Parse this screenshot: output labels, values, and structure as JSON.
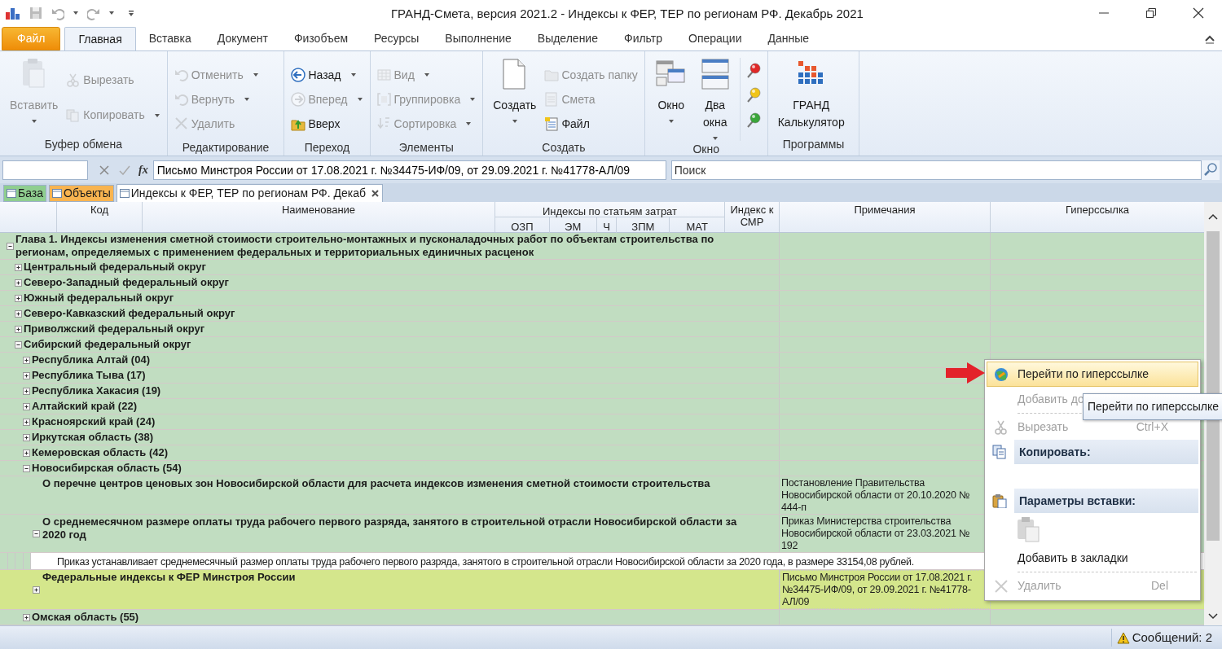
{
  "window": {
    "title": "ГРАНД-Смета, версия 2021.2 - Индексы к ФЕР, ТЕР по регионам РФ. Декабрь 2021"
  },
  "ribbon_tabs": [
    {
      "label": "Файл",
      "kind": "file",
      "selected": false
    },
    {
      "label": "Главная",
      "kind": "tab",
      "selected": true
    },
    {
      "label": "Вставка",
      "kind": "tab",
      "selected": false
    },
    {
      "label": "Документ",
      "kind": "tab",
      "selected": false
    },
    {
      "label": "Физобъем",
      "kind": "tab",
      "selected": false
    },
    {
      "label": "Ресурсы",
      "kind": "tab",
      "selected": false
    },
    {
      "label": "Выполнение",
      "kind": "tab",
      "selected": false
    },
    {
      "label": "Выделение",
      "kind": "tab",
      "selected": false
    },
    {
      "label": "Фильтр",
      "kind": "tab",
      "selected": false
    },
    {
      "label": "Операции",
      "kind": "tab",
      "selected": false
    },
    {
      "label": "Данные",
      "kind": "tab",
      "selected": false
    }
  ],
  "ribbon_groups": [
    {
      "label": "Буфер обмена",
      "buttons": [
        {
          "label": "Вставить",
          "kind": "large",
          "disabled": true,
          "dropdown": true
        },
        {
          "label": "Вырезать",
          "kind": "small",
          "disabled": true,
          "dropdown": false
        },
        {
          "label": "Копировать",
          "kind": "small",
          "disabled": true,
          "dropdown": true
        }
      ]
    },
    {
      "label": "Редактирование",
      "buttons": [
        {
          "label": "Отменить",
          "kind": "small",
          "disabled": true,
          "dropdown": true
        },
        {
          "label": "Вернуть",
          "kind": "small",
          "disabled": true,
          "dropdown": true
        },
        {
          "label": "Удалить",
          "kind": "small",
          "disabled": true,
          "dropdown": false
        }
      ]
    },
    {
      "label": "Переход",
      "buttons": [
        {
          "label": "Назад",
          "kind": "small",
          "disabled": false,
          "dropdown": true
        },
        {
          "label": "Вперед",
          "kind": "small",
          "disabled": true,
          "dropdown": true
        },
        {
          "label": "Вверх",
          "kind": "small",
          "disabled": false,
          "dropdown": false
        }
      ]
    },
    {
      "label": "Элементы",
      "buttons": [
        {
          "label": "Вид",
          "kind": "small",
          "disabled": true,
          "dropdown": true
        },
        {
          "label": "Группировка",
          "kind": "small",
          "disabled": true,
          "dropdown": true
        },
        {
          "label": "Сортировка",
          "kind": "small",
          "disabled": true,
          "dropdown": true
        }
      ]
    },
    {
      "label": "Создать",
      "buttons": [
        {
          "label": "Создать",
          "kind": "large",
          "disabled": false,
          "dropdown": true
        },
        {
          "label": "Создать папку",
          "kind": "small",
          "disabled": true,
          "dropdown": false
        },
        {
          "label": "Смета",
          "kind": "small",
          "disabled": true,
          "dropdown": false
        },
        {
          "label": "Файл",
          "kind": "small",
          "disabled": false,
          "dropdown": false
        }
      ]
    },
    {
      "label": "Окно",
      "buttons": [
        {
          "label": "Окно",
          "kind": "large",
          "disabled": false,
          "dropdown": true
        },
        {
          "label": "Два окна",
          "kind": "large",
          "disabled": false,
          "dropdown": true
        },
        {
          "kind": "pin",
          "color": "#e02828"
        },
        {
          "kind": "pin",
          "color": "#f0c419"
        },
        {
          "kind": "pin",
          "color": "#3aa63a"
        }
      ]
    },
    {
      "label": "Программы",
      "buttons": [
        {
          "label": "ГРАНД Калькулятор",
          "kind": "large",
          "disabled": false,
          "dropdown": false
        }
      ]
    }
  ],
  "formula_bar": {
    "function_label": "fx",
    "value": "Письмо Минстроя России от 17.08.2021 г. №34475-ИФ/09, от 29.09.2021 г. №41778-АЛ/09",
    "search_placeholder": "Поиск"
  },
  "document_tabs": [
    {
      "label": "База",
      "color": "#8fce8f",
      "selected": false,
      "closable": false
    },
    {
      "label": "Объекты",
      "color": "#f8b450",
      "selected": false,
      "closable": false
    },
    {
      "label": "Индексы к ФЕР, ТЕР по регионам РФ. Декаб",
      "color": "#ffffff",
      "selected": true,
      "closable": true
    }
  ],
  "grid": {
    "columns": [
      "Код",
      "Наименование"
    ],
    "column_group": {
      "label": "Индексы по статьям затрат",
      "subcolumns": [
        "ОЗП",
        "ЭМ",
        "Ч",
        "ЗПМ",
        "МАТ"
      ]
    },
    "columns_after": [
      "Индекс к СМР",
      "Примечания",
      "Гиперссылка"
    ],
    "rows": [
      {
        "kind": "group",
        "name": "Глава 1. Индексы изменения сметной стоимости строительно-монтажных и пусконаладочных работ по объектам строительства по регионам, определяемых с применением федеральных и территориальных единичных расценок",
        "expanded": true,
        "selected": false,
        "children": [
          {
            "kind": "group",
            "name": "Центральный федеральный округ",
            "expanded": false,
            "selected": false
          },
          {
            "kind": "group",
            "name": "Северо-Западный федеральный округ",
            "expanded": false,
            "selected": false
          },
          {
            "kind": "group",
            "name": "Южный федеральный округ",
            "expanded": false,
            "selected": false
          },
          {
            "kind": "group",
            "name": "Северо-Кавказский федеральный округ",
            "expanded": false,
            "selected": false
          },
          {
            "kind": "group",
            "name": "Приволжский федеральный округ",
            "expanded": false,
            "selected": false
          },
          {
            "kind": "group",
            "name": "Сибирский федеральный округ",
            "expanded": true,
            "selected": false,
            "children": [
              {
                "kind": "group",
                "name": "Республика Алтай (04)",
                "expanded": false,
                "selected": false
              },
              {
                "kind": "group",
                "name": "Республика Тыва (17)",
                "expanded": false,
                "selected": false
              },
              {
                "kind": "group",
                "name": "Республика Хакасия (19)",
                "expanded": false,
                "selected": false
              },
              {
                "kind": "group",
                "name": "Алтайский край (22)",
                "expanded": false,
                "selected": false
              },
              {
                "kind": "group",
                "name": "Красноярский край (24)",
                "expanded": false,
                "selected": false
              },
              {
                "kind": "group",
                "name": "Иркутская область (38)",
                "expanded": false,
                "selected": false
              },
              {
                "kind": "group",
                "name": "Кемеровская область (42)",
                "expanded": false,
                "selected": false
              },
              {
                "kind": "group",
                "name": "Новосибирская область (54)",
                "expanded": true,
                "selected": false,
                "children": [
                  {
                    "kind": "document",
                    "name": "О перечне центров ценовых зон Новосибирской области для расчета индексов изменения сметной стоимости строительства",
                    "notes": "Постановление Правительства Новосибирской области от 20.10.2020 № 444-п",
                    "selected": false
                  },
                  {
                    "kind": "document",
                    "name": "О среднемесячном размере оплаты труда рабочего первого разряда, занятого в строительной отрасли Новосибирской области за 2020 год",
                    "notes": "Приказ Министерства строительства Новосибирской области от 23.03.2021 № 192",
                    "expanded": true,
                    "selected": false,
                    "children": [
                      {
                        "kind": "comment",
                        "text": "Приказ устанавливает среднемесячный размер оплаты труда рабочего первого разряда, занятого в строительной отрасли Новосибирской области за 2020 года, в размере 33154,08 рублей."
                      }
                    ]
                  },
                  {
                    "kind": "document",
                    "name": "Федеральные индексы к ФЕР Минстроя России",
                    "notes": "Письмо Минстроя России от 17.08.2021 г. №34475-ИФ/09, от 29.09.2021 г. №41778-АЛ/09",
                    "expanded": false,
                    "selected": true
                  }
                ]
              },
              {
                "kind": "group",
                "name": "Омская область (55)",
                "expanded": false,
                "selected": false
              }
            ]
          }
        ]
      }
    ]
  },
  "context_menu": {
    "items": [
      {
        "kind": "item",
        "label": "Перейти по гиперссылке",
        "selected": true,
        "disabled": false
      },
      {
        "kind": "item",
        "label": "Добавить до",
        "selected": false,
        "disabled": true
      },
      {
        "kind": "separator"
      },
      {
        "kind": "item",
        "label": "Вырезать",
        "shortcut": "Ctrl+X",
        "selected": false,
        "disabled": true
      },
      {
        "kind": "header",
        "label": "Копировать:"
      },
      {
        "kind": "header",
        "label": "Параметры вставки:"
      },
      {
        "kind": "paste-option"
      },
      {
        "kind": "item",
        "label": "Добавить в закладки",
        "selected": false,
        "disabled": false
      },
      {
        "kind": "separator"
      },
      {
        "kind": "item",
        "label": "Удалить",
        "shortcut": "Del",
        "selected": false,
        "disabled": true
      }
    ]
  },
  "tooltip": "Перейти по гиперссылке",
  "status_bar": {
    "messages": "Сообщений: 2"
  }
}
